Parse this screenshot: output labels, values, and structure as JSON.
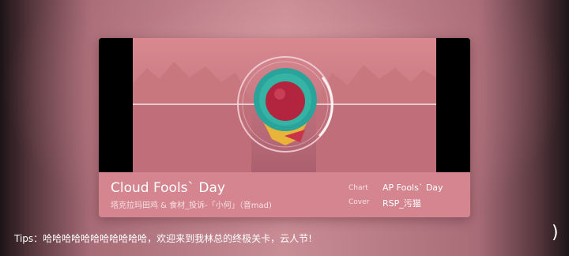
{
  "song": {
    "title": "Cloud Fools` Day",
    "artist": "塔克拉玛田鸡 & 食材_投诉-「小何」（音mad)"
  },
  "meta": {
    "chart_label": "Chart",
    "chart_value": "AP Fools` Day",
    "cover_label": "Cover",
    "cover_value": "RSP_污猫"
  },
  "tips": "Tips：哈哈哈哈哈哈哈哈哈哈哈，欢迎来到我林总的终极关卡，云人节!",
  "nav": {
    "next_symbol": ")"
  },
  "colors": {
    "info_bar": "#d4858f",
    "preview_sky": "#d9888f",
    "disc_teal": "#2aa49a",
    "disc_core": "#b3253f",
    "disc_yellow": "#e8b43a"
  }
}
